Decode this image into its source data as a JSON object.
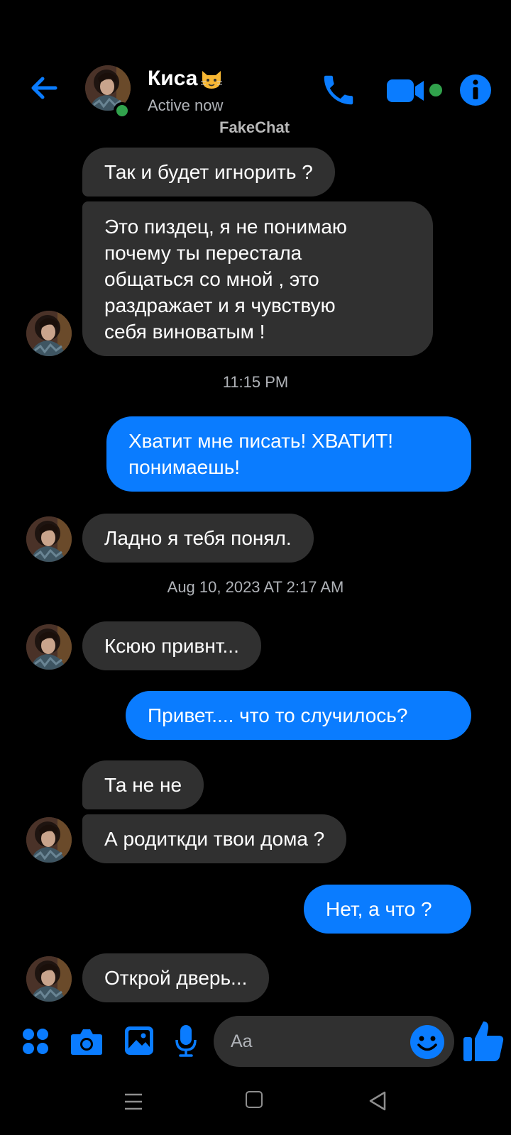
{
  "header": {
    "name": "Киса",
    "name_emoji": "cat-face-emoji",
    "status": "Active now",
    "watermark": "FakeChat",
    "icons": [
      "back-arrow-icon",
      "phone-icon",
      "video-camera-icon",
      "info-icon"
    ],
    "online": true
  },
  "messages": [
    {
      "from": "them",
      "text": "Так и будет игнорить ?"
    },
    {
      "from": "them",
      "text": "Это пиздец,  я не понимаю\nпочему ты перестала\nобщаться со мной , это\nраздражает и я чувствую\nсебя виноватым !"
    },
    {
      "from": "them",
      "text": "Ладно я тебя понял."
    },
    {
      "from": "me",
      "text": "Хватит мне писать! ХВАТИТ!\nпонимаешь!"
    },
    {
      "from": "them",
      "text": "Ксюю привнт..."
    },
    {
      "from": "me",
      "text": "Привет.... что то случилось?"
    },
    {
      "from": "them",
      "text": "Та не не"
    },
    {
      "from": "them",
      "text": "А родиткди твои дома ?"
    },
    {
      "from": "me",
      "text": "Нет, а что ?"
    },
    {
      "from": "them",
      "text": "Открой дверь..."
    }
  ],
  "timestamps": [
    "11:15 PM",
    "Aug 10, 2023 AT 2:17 AM"
  ],
  "composer": {
    "placeholder": "Aa",
    "icons": [
      "apps-grid-icon",
      "camera-icon",
      "gallery-icon",
      "microphone-icon",
      "emoji-icon",
      "thumbs-up-icon"
    ]
  },
  "nav": {
    "icons": [
      "recent-apps-icon",
      "home-icon",
      "back-icon"
    ]
  },
  "colors": {
    "accent": "#0a7cff",
    "incoming_bubble": "#303030",
    "online": "#31a24c",
    "background": "#000000"
  }
}
